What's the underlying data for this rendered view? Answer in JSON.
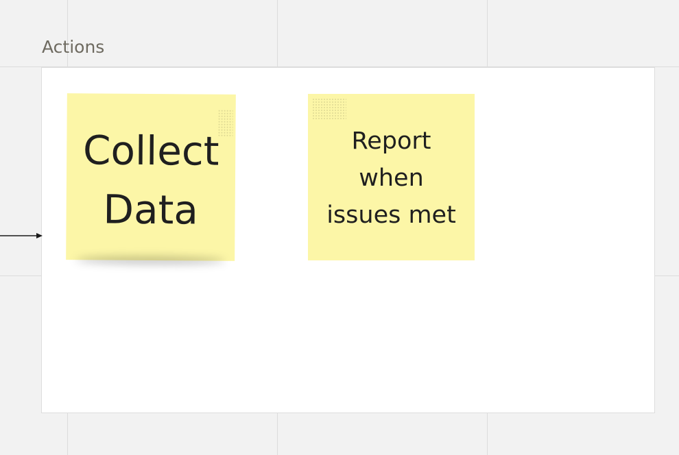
{
  "frame": {
    "title": "Actions"
  },
  "stickies": [
    {
      "lines": [
        "Collect",
        "Data"
      ]
    },
    {
      "lines": [
        "Report",
        "when",
        "issues met"
      ]
    }
  ],
  "colors": {
    "canvas": "#f2f2f2",
    "frame": "#ffffff",
    "sticky": "#fcf6a7",
    "text": "#1f1f1f"
  }
}
